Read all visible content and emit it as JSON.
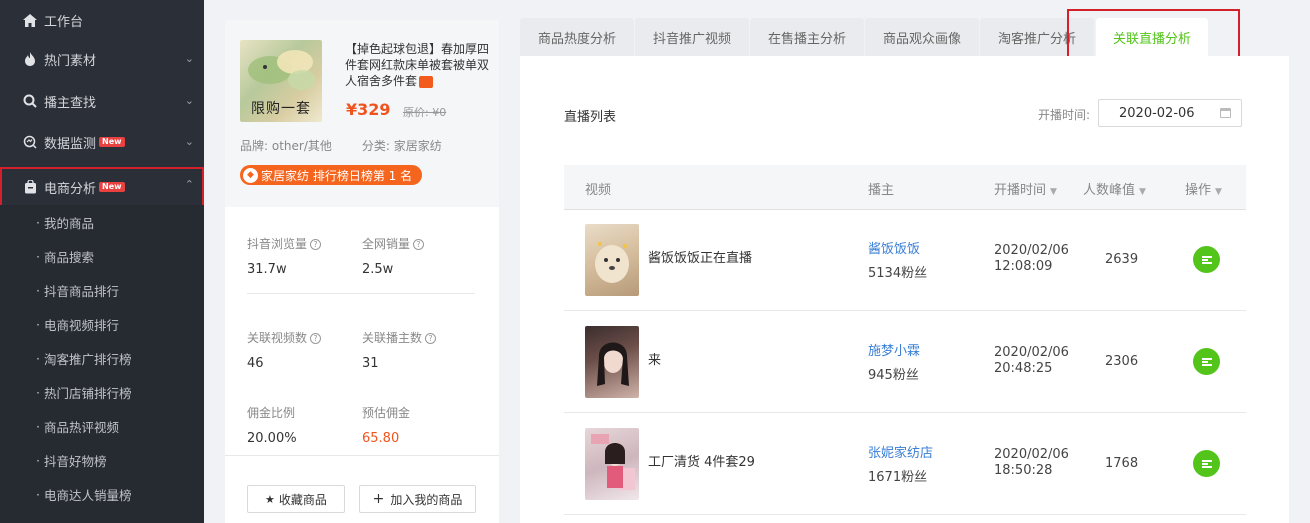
{
  "sidebar": {
    "items": [
      {
        "label": "工作台",
        "icon": "home-icon"
      },
      {
        "label": "热门素材",
        "icon": "fire-icon"
      },
      {
        "label": "播主查找",
        "icon": "search-icon"
      },
      {
        "label": "数据监测",
        "icon": "monitor-icon",
        "badge": "New"
      },
      {
        "label": "电商分析",
        "icon": "bag-icon",
        "badge": "New"
      }
    ],
    "sub_items": [
      "我的商品",
      "商品搜索",
      "抖音商品排行",
      "电商视频排行",
      "淘客推广排行榜",
      "热门店铺排行榜",
      "商品热评视频",
      "抖音好物榜",
      "电商达人销量榜"
    ]
  },
  "product": {
    "thumb_tag": "限购一套",
    "title": "【掉色起球包退】春加厚四件套网红款床单被套被单双人宿舍多件套",
    "price": "¥329",
    "original_price": "原价: ¥0",
    "brand": "品牌: other/其他",
    "category": "分类: 家居家纺",
    "rank": "家居家纺 排行榜日榜第 1 名",
    "stats": {
      "douyin_views_label": "抖音浏览量",
      "douyin_views": "31.7w",
      "total_sales_label": "全网销量",
      "total_sales": "2.5w",
      "related_videos_label": "关联视频数",
      "related_videos": "46",
      "related_anchors_label": "关联播主数",
      "related_anchors": "31",
      "commission_rate_label": "佣金比例",
      "commission_rate": "20.00%",
      "est_commission_label": "预估佣金",
      "est_commission": "65.80"
    },
    "favorite_button": "收藏商品",
    "add_button": "加入我的商品"
  },
  "tabs": [
    "商品热度分析",
    "抖音推广视频",
    "在售播主分析",
    "商品观众画像",
    "淘客推广分析",
    "关联直播分析"
  ],
  "active_tab": "关联直播分析",
  "live": {
    "title": "直播列表",
    "date_label": "开播时间:",
    "date_value": "2020-02-06",
    "columns": [
      "视频",
      "播主",
      "开播时间",
      "人数峰值",
      "操作"
    ],
    "rows": [
      {
        "title": "酱饭饭饭正在直播",
        "anchor": "酱饭饭饭",
        "fans": "5134粉丝",
        "date": "2020/02/06",
        "time": "12:08:09",
        "peak": "2639"
      },
      {
        "title": "来",
        "anchor": "施梦小霖",
        "fans": "945粉丝",
        "date": "2020/02/06",
        "time": "20:48:25",
        "peak": "2306"
      },
      {
        "title": "工厂清货 4件套29",
        "anchor": "张妮家纺店",
        "fans": "1671粉丝",
        "date": "2020/02/06",
        "time": "18:50:28",
        "peak": "1768"
      }
    ]
  },
  "colors": {
    "accent_green": "#52c41a",
    "price_orange": "#f0541e",
    "highlight_red": "#d4202a",
    "sidebar_bg": "#2b2f38"
  }
}
